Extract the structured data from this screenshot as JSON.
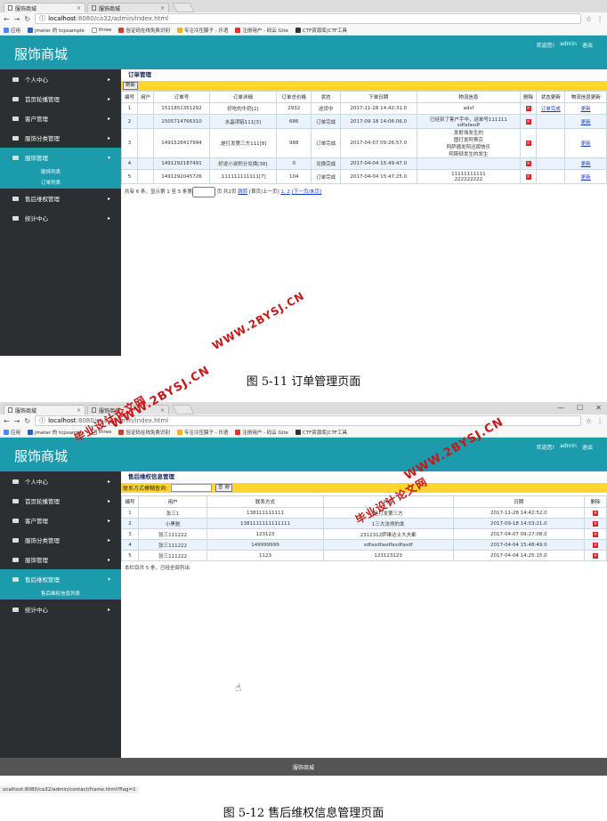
{
  "shot1": {
    "browser": {
      "tabs": [
        "服饰商城",
        "服饰商城"
      ],
      "url_host": "localhost",
      "url_path": ":8080/ca32/admin/index.html",
      "bookmarks": [
        "应用",
        "jmeter 的 tcpsample",
        "three",
        "验证码在线免费识别",
        "专注冷压膜子 - 乐语",
        "注册用户 - 码云 Gite",
        "CTF资源库|CTF工具"
      ]
    },
    "header": {
      "brand": "服饰商城",
      "welcome": "欢迎您!",
      "user": "admin",
      "logout": "退出"
    },
    "sidebar": {
      "items": [
        "个人中心",
        "首页轮播管理",
        "客户管理",
        "服饰分类管理",
        "服饰管理",
        "售后维权管理",
        "统计中心"
      ],
      "active_index": 4,
      "sub_items": [
        "服饰列表",
        "订单列表"
      ]
    },
    "main": {
      "title": "订单管理",
      "refresh_label": "刷新",
      "columns": [
        "编号",
        "用户",
        "订单号",
        "订单详细",
        "订单总价格",
        "状态",
        "下单日期",
        "物流信息",
        "删除",
        "状态更新",
        "物流信息更新"
      ],
      "rows": [
        {
          "no": "1",
          "user": "",
          "order_no": "1511851351292",
          "detail": "好吃的牛奶[2]",
          "price": "2932",
          "status": "送货中",
          "date": "2017-11-28 14:42:31.0",
          "logistics": [
            "adsf"
          ],
          "update_status": "订单完成",
          "update_logistics": "更新"
        },
        {
          "no": "2",
          "user": "",
          "order_no": "1505714766310",
          "detail": "水晶项链111[3]",
          "price": "686",
          "status": "订单完成",
          "date": "2017-09-18 14:06:06.0",
          "logistics": [
            "已经到了客户手中，运单号111111",
            "sdfafasdf"
          ],
          "update_status": "",
          "update_logistics": "更新"
        },
        {
          "no": "3",
          "user": "",
          "order_no": "1491528417994",
          "detail": ",是打发第三方111[8]",
          "price": "988",
          "status": "订单完成",
          "date": "2017-04-07 09:26:57.0",
          "logistics": [
            "发射场发生的",
            "图打发阿蒂芬",
            "阿萨德发阿迅周快乐",
            "阿斯顿发生的发生"
          ],
          "update_status": "",
          "update_logistics": "更新"
        },
        {
          "no": "4",
          "user": "",
          "order_no": "1491292187491",
          "detail": "好说小说积分兑换[38]",
          "price": "0",
          "status": "兑换完成",
          "date": "2017-04-04 15:49:47.0",
          "logistics": [
            ""
          ],
          "update_status": "",
          "update_logistics": "更新"
        },
        {
          "no": "5",
          "user": "",
          "order_no": "1491292045726",
          "detail": ",111111111111[7]",
          "price": "104",
          "status": "订单完成",
          "date": "2017-04-04 15:47:25.0",
          "logistics": [
            "11111111111",
            "222222222"
          ],
          "update_status": "",
          "update_logistics": "更新"
        }
      ],
      "pager": {
        "text_before": "共有 6 条，显示第 1 至 5 条第",
        "text_after": "页 共2页",
        "jump": "跳转",
        "nav": "[首页/上一页]",
        "pages": "1, 2",
        "next": "[下一页/末页]"
      }
    },
    "caption": "图 5-11 订单管理页面"
  },
  "shot2": {
    "browser": {
      "tabs": [
        "服饰商城",
        "服饰商城"
      ],
      "url_host": "localhost",
      "url_path": ":8080/ca32/admin/index.html",
      "bookmarks": [
        "应用",
        "jmeter 的 tcpsample",
        "three",
        "验证码在线免费识别",
        "专注冷压膜子 - 乐语",
        "注册用户 - 码云 Gite",
        "CTF资源库|CTF工具"
      ]
    },
    "header": {
      "brand": "服饰商城",
      "welcome": "欢迎您!",
      "user": "admin",
      "logout": "退出"
    },
    "sidebar": {
      "items": [
        "个人中心",
        "首页轮播管理",
        "客户管理",
        "服饰分类管理",
        "服饰管理",
        "售后维权管理",
        "统计中心"
      ],
      "active_index": 5,
      "sub_items": [
        "售后维权信息列表"
      ]
    },
    "main": {
      "title": "售后维权信息管理",
      "search_label": "联系方式模糊查询:",
      "search_button": "查 询",
      "columns": [
        "编号",
        "用户",
        "联系方式",
        "内容",
        "日期",
        "删除"
      ],
      "rows": [
        {
          "no": "1",
          "user": "张三1",
          "contact": "138111111111",
          "content": "是打发第三方",
          "date": "2017-11-28 14:42:52.0"
        },
        {
          "no": "2",
          "user": "小黑驰",
          "contact": "1381111111111111",
          "content": "1三大法师的发",
          "date": "2017-09-18 14:03:21.0"
        },
        {
          "no": "3",
          "user": "张三111222",
          "contact": "123123",
          "content": "2312312萨维达士大夫都",
          "date": "2017-04-07 09:27:08.0"
        },
        {
          "no": "4",
          "user": "张三111222",
          "contact": "149999999",
          "content": "sdfasdfasdfasdfasdf",
          "date": "2017-04-04 15:48:49.0"
        },
        {
          "no": "5",
          "user": "张三111222",
          "contact": "1123",
          "content": "123123123",
          "date": "2017-04-04 14:25:15.0"
        }
      ],
      "summary": "本栏目共 5 条，已经全部列出"
    },
    "footer": "服饰商城",
    "status_url": "ocalhost:8080/ca32/admin/contact/frame.html?flag=1",
    "caption": "图 5-12 售后维权信息管理页面"
  },
  "watermarks": [
    "毕业设计论文网",
    "WWW.2BYSJ.CN"
  ]
}
